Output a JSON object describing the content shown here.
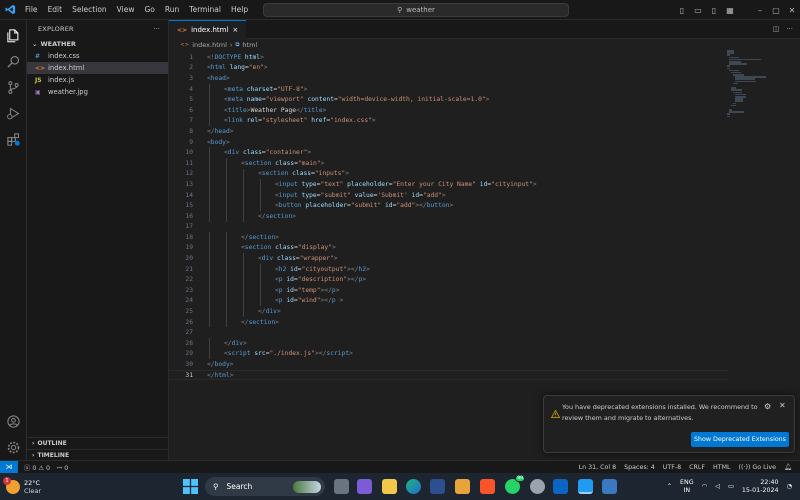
{
  "menu": [
    "File",
    "Edit",
    "Selection",
    "View",
    "Go",
    "Run",
    "Terminal",
    "Help"
  ],
  "search": {
    "text": "weather"
  },
  "sidebar": {
    "title": "EXPLORER",
    "folder": "WEATHER",
    "files": [
      {
        "name": "index.css",
        "icon": "#",
        "icon_color": "#519aba"
      },
      {
        "name": "index.html",
        "icon": "<>",
        "icon_color": "#e37933"
      },
      {
        "name": "index.js",
        "icon": "JS",
        "icon_color": "#cbcb41"
      },
      {
        "name": "weather.jpg",
        "icon": "▣",
        "icon_color": "#a074c4"
      }
    ],
    "outline": "OUTLINE",
    "timeline": "TIMELINE"
  },
  "tab": {
    "label": "index.html",
    "close": "×"
  },
  "breadcrumb": {
    "file": "index.html",
    "sep": "›",
    "node": "html"
  },
  "code": [
    {
      "n": "1",
      "ind": 0,
      "tok": [
        [
          "p",
          "<!"
        ],
        [
          "t",
          "DOCTYPE"
        ],
        [
          "a",
          " html"
        ],
        [
          "p",
          ">"
        ]
      ]
    },
    {
      "n": "2",
      "ind": 0,
      "tok": [
        [
          "p",
          "<"
        ],
        [
          "t",
          "html"
        ],
        [
          "a",
          " lang"
        ],
        [
          "x",
          "="
        ],
        [
          "s",
          "\"en\""
        ],
        [
          "p",
          ">"
        ]
      ]
    },
    {
      "n": "3",
      "ind": 0,
      "tok": [
        [
          "p",
          "<"
        ],
        [
          "t",
          "head"
        ],
        [
          "p",
          ">"
        ]
      ]
    },
    {
      "n": "4",
      "ind": 1,
      "tok": [
        [
          "p",
          "<"
        ],
        [
          "t",
          "meta"
        ],
        [
          "a",
          " charset"
        ],
        [
          "x",
          "="
        ],
        [
          "s",
          "\"UTF-8\""
        ],
        [
          "p",
          ">"
        ]
      ]
    },
    {
      "n": "5",
      "ind": 1,
      "tok": [
        [
          "p",
          "<"
        ],
        [
          "t",
          "meta"
        ],
        [
          "a",
          " name"
        ],
        [
          "x",
          "="
        ],
        [
          "s",
          "\"viewport\""
        ],
        [
          "a",
          " content"
        ],
        [
          "x",
          "="
        ],
        [
          "s",
          "\"width=device-width, initial-scale=1.0\""
        ],
        [
          "p",
          ">"
        ]
      ]
    },
    {
      "n": "6",
      "ind": 1,
      "tok": [
        [
          "p",
          "<"
        ],
        [
          "t",
          "title"
        ],
        [
          "p",
          ">"
        ],
        [
          "x",
          "Weather Page"
        ],
        [
          "p",
          "</"
        ],
        [
          "t",
          "title"
        ],
        [
          "p",
          ">"
        ]
      ]
    },
    {
      "n": "7",
      "ind": 1,
      "tok": [
        [
          "p",
          "<"
        ],
        [
          "t",
          "link"
        ],
        [
          "a",
          " rel"
        ],
        [
          "x",
          "="
        ],
        [
          "s",
          "\"stylesheet\""
        ],
        [
          "a",
          " href"
        ],
        [
          "x",
          "="
        ],
        [
          "s",
          "\"index.css\""
        ],
        [
          "p",
          ">"
        ]
      ]
    },
    {
      "n": "8",
      "ind": 0,
      "tok": [
        [
          "p",
          "</"
        ],
        [
          "t",
          "head"
        ],
        [
          "p",
          ">"
        ]
      ]
    },
    {
      "n": "9",
      "ind": 0,
      "tok": [
        [
          "p",
          "<"
        ],
        [
          "t",
          "body"
        ],
        [
          "p",
          ">"
        ]
      ]
    },
    {
      "n": "10",
      "ind": 1,
      "tok": [
        [
          "p",
          "<"
        ],
        [
          "t",
          "div"
        ],
        [
          "a",
          " class"
        ],
        [
          "x",
          "="
        ],
        [
          "s",
          "\"container\""
        ],
        [
          "p",
          ">"
        ]
      ]
    },
    {
      "n": "11",
      "ind": 2,
      "tok": [
        [
          "p",
          "<"
        ],
        [
          "t",
          "section"
        ],
        [
          "a",
          " class"
        ],
        [
          "x",
          "="
        ],
        [
          "s",
          "\"main\""
        ],
        [
          "p",
          ">"
        ]
      ]
    },
    {
      "n": "12",
      "ind": 3,
      "tok": [
        [
          "p",
          "<"
        ],
        [
          "t",
          "section"
        ],
        [
          "a",
          " class"
        ],
        [
          "x",
          "="
        ],
        [
          "s",
          "\"inputs\""
        ],
        [
          "p",
          ">"
        ]
      ]
    },
    {
      "n": "13",
      "ind": 4,
      "tok": [
        [
          "p",
          "<"
        ],
        [
          "t",
          "input"
        ],
        [
          "a",
          " type"
        ],
        [
          "x",
          "="
        ],
        [
          "s",
          "\"text\""
        ],
        [
          "a",
          " placeholder"
        ],
        [
          "x",
          "="
        ],
        [
          "s",
          "\"Enter your City Name\""
        ],
        [
          "a",
          " id"
        ],
        [
          "x",
          "="
        ],
        [
          "s",
          "\"cityinput\""
        ],
        [
          "p",
          ">"
        ]
      ]
    },
    {
      "n": "14",
      "ind": 4,
      "tok": [
        [
          "p",
          "<"
        ],
        [
          "t",
          "input"
        ],
        [
          "a",
          " type"
        ],
        [
          "x",
          "="
        ],
        [
          "s",
          "\"submit\""
        ],
        [
          "a",
          " value"
        ],
        [
          "x",
          "="
        ],
        [
          "s",
          "'Submit'"
        ],
        [
          "a",
          " id"
        ],
        [
          "x",
          "="
        ],
        [
          "s",
          "\"add\""
        ],
        [
          "p",
          ">"
        ]
      ]
    },
    {
      "n": "15",
      "ind": 4,
      "tok": [
        [
          "p",
          "<"
        ],
        [
          "t",
          "button"
        ],
        [
          "a",
          " placeholder"
        ],
        [
          "x",
          "="
        ],
        [
          "s",
          "\"submit\""
        ],
        [
          "a",
          " id"
        ],
        [
          "x",
          "="
        ],
        [
          "s",
          "\"add\""
        ],
        [
          "p",
          "></"
        ],
        [
          "t",
          "button"
        ],
        [
          "p",
          ">"
        ]
      ]
    },
    {
      "n": "16",
      "ind": 3,
      "tok": [
        [
          "p",
          "</"
        ],
        [
          "t",
          "section"
        ],
        [
          "p",
          ">"
        ]
      ]
    },
    {
      "n": "17",
      "ind": 0,
      "tok": []
    },
    {
      "n": "18",
      "ind": 2,
      "tok": [
        [
          "p",
          "</"
        ],
        [
          "t",
          "section"
        ],
        [
          "p",
          ">"
        ]
      ]
    },
    {
      "n": "19",
      "ind": 2,
      "tok": [
        [
          "p",
          "<"
        ],
        [
          "t",
          "section"
        ],
        [
          "a",
          " class"
        ],
        [
          "x",
          "="
        ],
        [
          "s",
          "\"display\""
        ],
        [
          "p",
          ">"
        ]
      ]
    },
    {
      "n": "20",
      "ind": 3,
      "tok": [
        [
          "p",
          "<"
        ],
        [
          "t",
          "div"
        ],
        [
          "a",
          " class"
        ],
        [
          "x",
          "="
        ],
        [
          "s",
          "\"wrapper\""
        ],
        [
          "p",
          ">"
        ]
      ]
    },
    {
      "n": "21",
      "ind": 4,
      "tok": [
        [
          "p",
          "<"
        ],
        [
          "t",
          "h2"
        ],
        [
          "a",
          " id"
        ],
        [
          "x",
          "="
        ],
        [
          "s",
          "\"cityoutput\""
        ],
        [
          "p",
          "></"
        ],
        [
          "t",
          "h2"
        ],
        [
          "p",
          ">"
        ]
      ]
    },
    {
      "n": "22",
      "ind": 4,
      "tok": [
        [
          "p",
          "<"
        ],
        [
          "t",
          "p"
        ],
        [
          "a",
          " id"
        ],
        [
          "x",
          "="
        ],
        [
          "s",
          "\"description\""
        ],
        [
          "p",
          "></"
        ],
        [
          "t",
          "p"
        ],
        [
          "p",
          ">"
        ]
      ]
    },
    {
      "n": "23",
      "ind": 4,
      "tok": [
        [
          "p",
          "<"
        ],
        [
          "t",
          "p"
        ],
        [
          "a",
          " id"
        ],
        [
          "x",
          "="
        ],
        [
          "s",
          "\"temp\""
        ],
        [
          "p",
          "></"
        ],
        [
          "t",
          "p"
        ],
        [
          "p",
          ">"
        ]
      ]
    },
    {
      "n": "24",
      "ind": 4,
      "tok": [
        [
          "p",
          "<"
        ],
        [
          "t",
          "p"
        ],
        [
          "a",
          " id"
        ],
        [
          "x",
          "="
        ],
        [
          "s",
          "\"wind\""
        ],
        [
          "p",
          "></"
        ],
        [
          "t",
          "p"
        ],
        [
          "x",
          " "
        ],
        [
          "p",
          ">"
        ]
      ]
    },
    {
      "n": "25",
      "ind": 3,
      "tok": [
        [
          "p",
          "</"
        ],
        [
          "t",
          "div"
        ],
        [
          "p",
          ">"
        ]
      ]
    },
    {
      "n": "26",
      "ind": 2,
      "tok": [
        [
          "p",
          "</"
        ],
        [
          "t",
          "section"
        ],
        [
          "p",
          ">"
        ]
      ]
    },
    {
      "n": "27",
      "ind": 0,
      "tok": []
    },
    {
      "n": "28",
      "ind": 1,
      "tok": [
        [
          "p",
          "</"
        ],
        [
          "t",
          "div"
        ],
        [
          "p",
          ">"
        ]
      ]
    },
    {
      "n": "29",
      "ind": 1,
      "tok": [
        [
          "p",
          "<"
        ],
        [
          "t",
          "script"
        ],
        [
          "a",
          " src"
        ],
        [
          "x",
          "="
        ],
        [
          "s",
          "\"./index.js\""
        ],
        [
          "p",
          "></"
        ],
        [
          "t",
          "script"
        ],
        [
          "p",
          ">"
        ]
      ]
    },
    {
      "n": "30",
      "ind": 0,
      "tok": [
        [
          "p",
          "</"
        ],
        [
          "t",
          "body"
        ],
        [
          "p",
          ">"
        ]
      ]
    },
    {
      "n": "31",
      "ind": 0,
      "tok": [
        [
          "p",
          "</"
        ],
        [
          "t",
          "html"
        ],
        [
          "p",
          ">"
        ]
      ]
    }
  ],
  "current_line": "31",
  "notification": {
    "text": "You have deprecated extensions installed. We recommend to review them and migrate to alternatives.",
    "button": "Show Deprecated Extensions"
  },
  "status": {
    "errors": "0",
    "warnings": "0",
    "ports": "0",
    "position": "Ln 31, Col 8",
    "spaces": "Spaces: 4",
    "encoding": "UTF-8",
    "eol": "CRLF",
    "language": "HTML",
    "golive": "Go Live"
  },
  "taskbar": {
    "temp": "22°C",
    "condition": "Clear",
    "search_label": "Search",
    "lang": "ENG",
    "region": "IN",
    "time": "22:40",
    "date": "15-01-2024",
    "badge": "1",
    "whatsapp_badge": "99"
  },
  "colors": {
    "accent": "#0078d4",
    "tag": "#569cd6",
    "attr": "#9cdcfe",
    "string": "#ce9178",
    "punct": "#808080"
  }
}
